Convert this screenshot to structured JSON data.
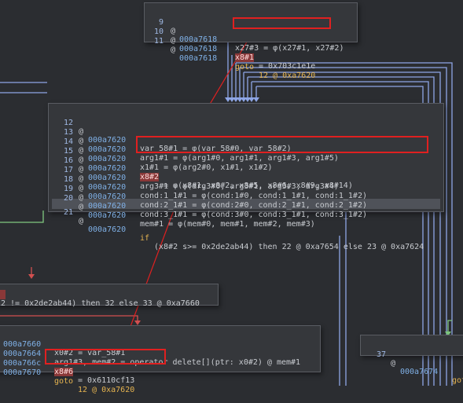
{
  "node_top": {
    "lines": [
      {
        "num": "9",
        "addr": "000a7618",
        "code": "x27#3 = φ(x27#1, x27#2)"
      },
      {
        "num": "10",
        "addr": "000a7618",
        "var": "x8#1",
        "code": " = 0x703c1e1e"
      },
      {
        "num": "11",
        "addr": "000a7618",
        "kw": "goto",
        "code": "12 @ 0xa7620"
      }
    ]
  },
  "node_main": {
    "lines": [
      {
        "num": "12",
        "addr": "000a7620",
        "code": "var_58#1 = φ(var_58#0, var_58#2)"
      },
      {
        "num": "13",
        "addr": "000a7620",
        "code": "arg1#1 = φ(arg1#0, arg1#1, arg1#3, arg1#5)"
      },
      {
        "num": "14",
        "addr": "000a7620",
        "code": "x1#1 = φ(arg2#0, x1#1, x1#2)"
      },
      {
        "num": "15",
        "addr": "000a7620",
        "var": "x8#2",
        "code": " = φ(x8#1, x8#2, x8#5, x8#6, x8#9, x8#14)"
      },
      {
        "num": "16",
        "addr": "000a7620",
        "code": "arg3#1 = φ(arg3#0, arg3#1, arg3#3, arg3#4)"
      },
      {
        "num": "17",
        "addr": "000a7620",
        "code": "cond:1_1#1 = φ(cond:1#0, cond:1_1#1, cond:1_1#2)"
      },
      {
        "num": "18",
        "addr": "000a7620",
        "code": "cond:2_1#1 = φ(cond:2#0, cond:2_1#1, cond:2_1#2)"
      },
      {
        "num": "19",
        "addr": "000a7620",
        "code": "cond:3_1#1 = φ(cond:3#0, cond:3_1#1, cond:3_1#2)"
      },
      {
        "num": "20",
        "addr": "000a7620",
        "code": "mem#1 = φ(mem#0, mem#1, mem#2, mem#3)"
      },
      {
        "num": "21",
        "addr": "000a7620",
        "kw": "if",
        "code": " (x8#2 s>= 0x2de2ab44) then 22 @ 0xa7654 else 23 @ 0xa7624"
      }
    ]
  },
  "node_mid_left": {
    "text": "2 != 0x2de2ab44) then 32 else 33 @ 0xa7660"
  },
  "node_bottom_left": {
    "lines": [
      {
        "addr": "000a7660",
        "code": "x0#2 = var_58#1"
      },
      {
        "addr": "000a7664",
        "code": "arg1#3, mem#2 = operator delete[](ptr: x0#2) @ mem#1"
      },
      {
        "addr": "000a766c",
        "var": "x8#6",
        "code": " = 0x6110cf13"
      },
      {
        "addr": "000a7670",
        "kw": "goto",
        "code": "12 @ 0xa7620"
      }
    ]
  },
  "node_right": {
    "num": "37",
    "addr": "000a7674",
    "code": "got"
  },
  "colors": {
    "background": "#2b2d31",
    "node": "#35373b",
    "edge_blue": "#8ea6e6",
    "edge_green": "#7fc87f",
    "edge_red": "#d25050",
    "highlight_red": "#e02020"
  }
}
